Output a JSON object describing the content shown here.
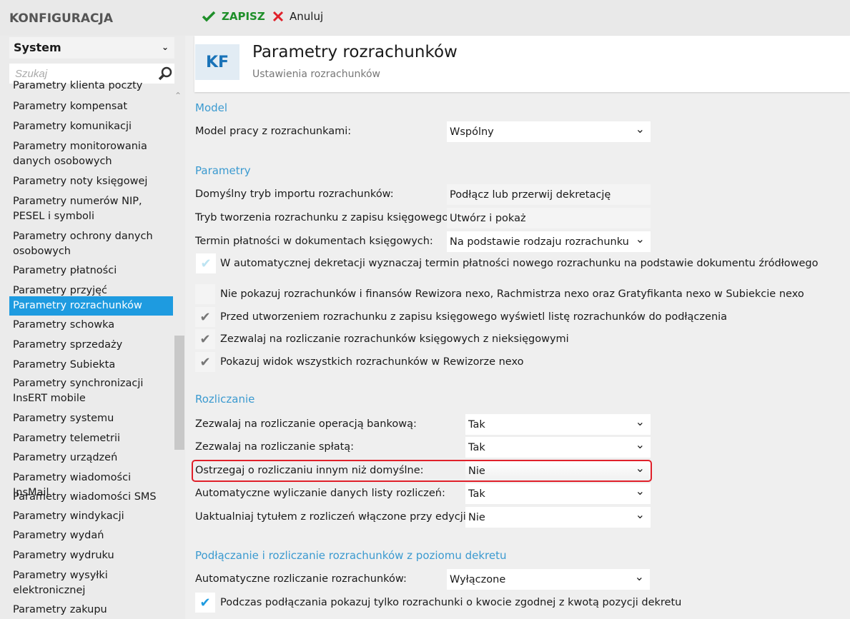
{
  "app": {
    "title": "KONFIGURACJA"
  },
  "toolbar": {
    "save": "ZAPISZ",
    "cancel": "Anuluj"
  },
  "sidebar": {
    "category": "System",
    "search_placeholder": "Szukaj",
    "items": [
      "Parametry klienta poczty",
      "Parametry kompensat",
      "Parametry komunikacji",
      "Parametry monitorowania danych osobowych",
      "Parametry noty księgowej",
      "Parametry numerów NIP, PESEL i symboli",
      "Parametry ochrony danych osobowych",
      "Parametry płatności",
      "Parametry przyjęć",
      "Parametry rozrachunków",
      "Parametry schowka",
      "Parametry sprzedaży",
      "Parametry Subiekta",
      "Parametry synchronizacji InsERT mobile",
      "Parametry systemu",
      "Parametry telemetrii",
      "Parametry urządzeń",
      "Parametry wiadomości InsMail",
      "Parametry wiadomości SMS",
      "Parametry windykacji",
      "Parametry wydań",
      "Parametry wydruku",
      "Parametry wysyłki elektronicznej",
      "Parametry zakupu"
    ],
    "selected": "Parametry rozrachunków"
  },
  "header": {
    "badge": "KF",
    "title": "Parametry rozrachunków",
    "subtitle": "Ustawienia rozrachunków"
  },
  "sections": {
    "model": "Model",
    "parametry": "Parametry",
    "rozliczanie": "Rozliczanie",
    "podlaczanie": "Podłączanie i rozliczanie rozrachunków z poziomu dekretu"
  },
  "fields": [
    {
      "label": "Model pracy z rozrachunkami:",
      "value": "Wspólny",
      "type": "select"
    },
    {
      "label": "Domyślny tryb importu rozrachunków:",
      "value": "Podłącz lub przerwij dekretację",
      "type": "readonly"
    },
    {
      "label": "Tryb tworzenia rozrachunku z zapisu księgowego:",
      "value": "Utwórz i pokaż",
      "type": "readonly"
    },
    {
      "label": "Termin płatności w dokumentach księgowych:",
      "value": "Na podstawie rodzaju rozrachunku",
      "type": "select"
    },
    {
      "label": "Zezwalaj na rozliczanie operacją bankową:",
      "value": "Tak",
      "type": "select"
    },
    {
      "label": "Zezwalaj na rozliczanie spłatą:",
      "value": "Tak",
      "type": "select"
    },
    {
      "label": "Ostrzegaj o rozliczaniu innym niż domyślne:",
      "value": "Nie",
      "type": "select",
      "highlighted": true
    },
    {
      "label": "Automatyczne wyliczanie danych listy rozliczeń:",
      "value": "Tak",
      "type": "select"
    },
    {
      "label": "Uaktualniaj tytułem z rozliczeń włączone przy edycji:",
      "value": "Nie",
      "type": "select"
    },
    {
      "label": "Automatyczne rozliczanie rozrachunków:",
      "value": "Wyłączone",
      "type": "select"
    }
  ],
  "checkboxes": [
    {
      "label": "W automatycznej dekretacji wyznaczaj termin płatności nowego rozrachunku na podstawie dokumentu źródłowego",
      "checked": true,
      "state": "disabled"
    },
    {
      "label": "Nie pokazuj rozrachunków i finansów Rewizora nexo, Rachmistrza nexo oraz Gratyfikanta nexo w Subiekcie nexo",
      "checked": false
    },
    {
      "label": "Przed utworzeniem rozrachunku z zapisu księgowego wyświetl listę rozrachunków do podłączenia",
      "checked": true
    },
    {
      "label": "Zezwalaj na rozliczanie rozrachunków księgowych z nieksięgowymi",
      "checked": true
    },
    {
      "label": "Pokazuj widok wszystkich rozrachunków w Rewizorze nexo",
      "checked": true
    },
    {
      "label": "Podczas podłączania pokazuj tylko rozrachunki o kwocie zgodnej z kwotą pozycji dekretu",
      "checked": true,
      "state": "active"
    }
  ],
  "colors": {
    "accent": "#1e9be0",
    "save": "#1f8f2a",
    "cancel": "#e0202a",
    "section": "#3b9ad0",
    "highlight": "#e0202a"
  }
}
